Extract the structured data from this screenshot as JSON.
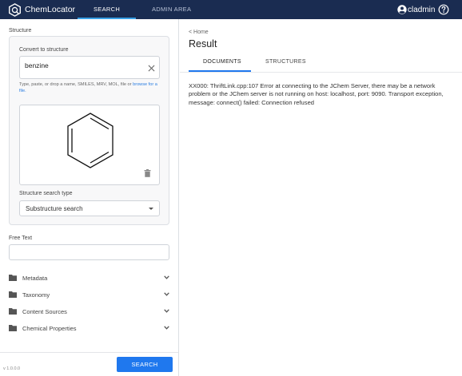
{
  "app": {
    "name": "ChemLocator"
  },
  "nav": {
    "tabs": [
      {
        "label": "SEARCH"
      },
      {
        "label": "ADMIN AREA"
      }
    ],
    "user": "cladmin"
  },
  "left": {
    "structure_label": "Structure",
    "convert": {
      "label": "Convert to structure",
      "value": "benzine",
      "hint_text": "Type, paste, or drop a name, SMILES, MRV, MOL, file or ",
      "hint_link": "browse for a file."
    },
    "search_type": {
      "label": "Structure search type",
      "selected": "Substructure search"
    },
    "free_text": {
      "label": "Free Text",
      "value": ""
    },
    "accordion": [
      {
        "label": "Metadata"
      },
      {
        "label": "Taxonomy"
      },
      {
        "label": "Content Sources"
      },
      {
        "label": "Chemical Properties"
      }
    ],
    "version": "v 1.0.0.0",
    "search_button": "SEARCH"
  },
  "right": {
    "breadcrumb": "< Home",
    "title": "Result",
    "tabs": [
      {
        "label": "DOCUMENTS"
      },
      {
        "label": "STRUCTURES"
      }
    ],
    "error": "XX000: ThriftLink.cpp:107 Error at connecting to the JChem Server, there may be a network problem or the JChem server is not running on host: localhost, port: 9090. Transport exception, message: connect() failed: Connection refused"
  },
  "colors": {
    "topbar": "#1a2c51",
    "accent": "#1f78ee",
    "nav_underline": "#39a0e6"
  },
  "icons": [
    "chemlocator-logo-icon",
    "user-account-icon",
    "help-icon",
    "close-icon",
    "trash-icon",
    "caret-down-icon",
    "folder-icon",
    "chevron-down-icon"
  ]
}
